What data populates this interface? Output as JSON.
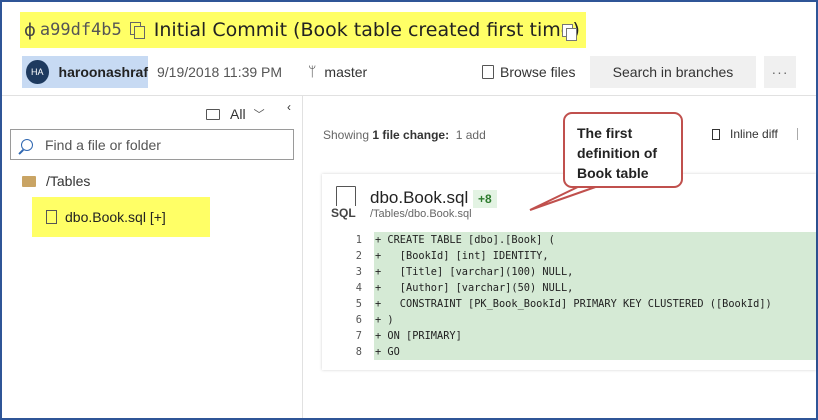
{
  "commit": {
    "hash": "a99df4b5",
    "message": "Initial Commit (Book table created first time)",
    "author_initials": "HA",
    "author": "haroonashraf",
    "date": "9/19/2018 11:39 PM",
    "branch": "master"
  },
  "toolbar": {
    "browse_files": "Browse files",
    "search_branches": "Search in branches",
    "more": "···"
  },
  "left_panel": {
    "filter": "All",
    "search_placeholder": "Find a file or folder",
    "folder": "/Tables",
    "file": "dbo.Book.sql [+]"
  },
  "summary": {
    "prefix": "Showing",
    "count": "1 file change:",
    "adds": "1 add"
  },
  "view_mode": "Inline diff",
  "callout": "The first definition of Book table",
  "diff": {
    "file_icon_label": "SQL",
    "file_name": "dbo.Book.sql",
    "added": "+8",
    "path": "/Tables/dbo.Book.sql",
    "lines": [
      {
        "n": "1",
        "text": "+ CREATE TABLE [dbo].[Book] ("
      },
      {
        "n": "2",
        "text": "+   [BookId] [int] IDENTITY,"
      },
      {
        "n": "3",
        "text": "+   [Title] [varchar](100) NULL,"
      },
      {
        "n": "4",
        "text": "+   [Author] [varchar](50) NULL,"
      },
      {
        "n": "5",
        "text": "+   CONSTRAINT [PK_Book_BookId] PRIMARY KEY CLUSTERED ([BookId])"
      },
      {
        "n": "6",
        "text": "+ )"
      },
      {
        "n": "7",
        "text": "+ ON [PRIMARY]"
      },
      {
        "n": "8",
        "text": "+ GO"
      }
    ]
  },
  "colors": {
    "highlight": "#ffff66",
    "author_bg": "#c7daf3",
    "callout_border": "#c0504d",
    "added_line": "#d5ead5"
  }
}
